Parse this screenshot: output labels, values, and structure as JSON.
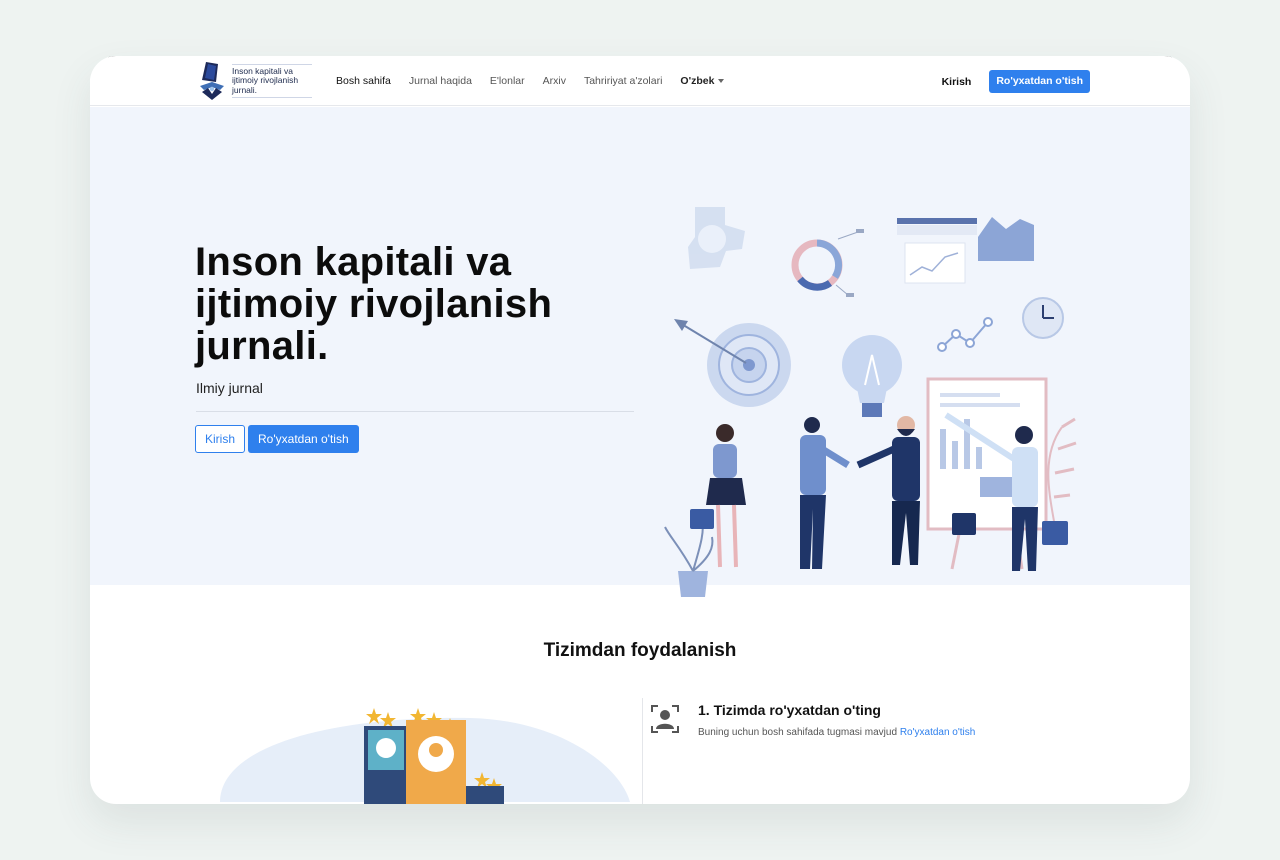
{
  "navbar": {
    "logo_text": "Inson kapitali va ijtimoiy rivojlanish jurnali.",
    "items": [
      {
        "label": "Bosh sahifa",
        "active": true
      },
      {
        "label": "Jurnal haqida"
      },
      {
        "label": "E'lonlar"
      },
      {
        "label": "Arxiv"
      },
      {
        "label": "Tahririyat a'zolari"
      }
    ],
    "language": "O'zbek",
    "login": "Kirish",
    "register": "Ro'yxatdan o'tish"
  },
  "hero": {
    "title": "Inson kapitali va ijtimoiy rivojlanish jurnali.",
    "subtitle": "Ilmiy jurnal",
    "login_button": "Kirish",
    "register_button": "Ro'yxatdan o'tish"
  },
  "usage": {
    "title": "Tizimdan foydalanish",
    "step1_title": "1. Tizimda ro'yxatdan o'ting",
    "step1_desc": "Buning uchun bosh sahifada tugmasi mavjud",
    "step1_link": "Ro'yxatdan o'tish"
  },
  "colors": {
    "primary": "#2f80ed",
    "hero_bg": "#f1f5fc",
    "page_bg": "#eef3f1"
  },
  "icons": {
    "logo": "journal-logo-icon",
    "step1": "user-frame-icon"
  }
}
